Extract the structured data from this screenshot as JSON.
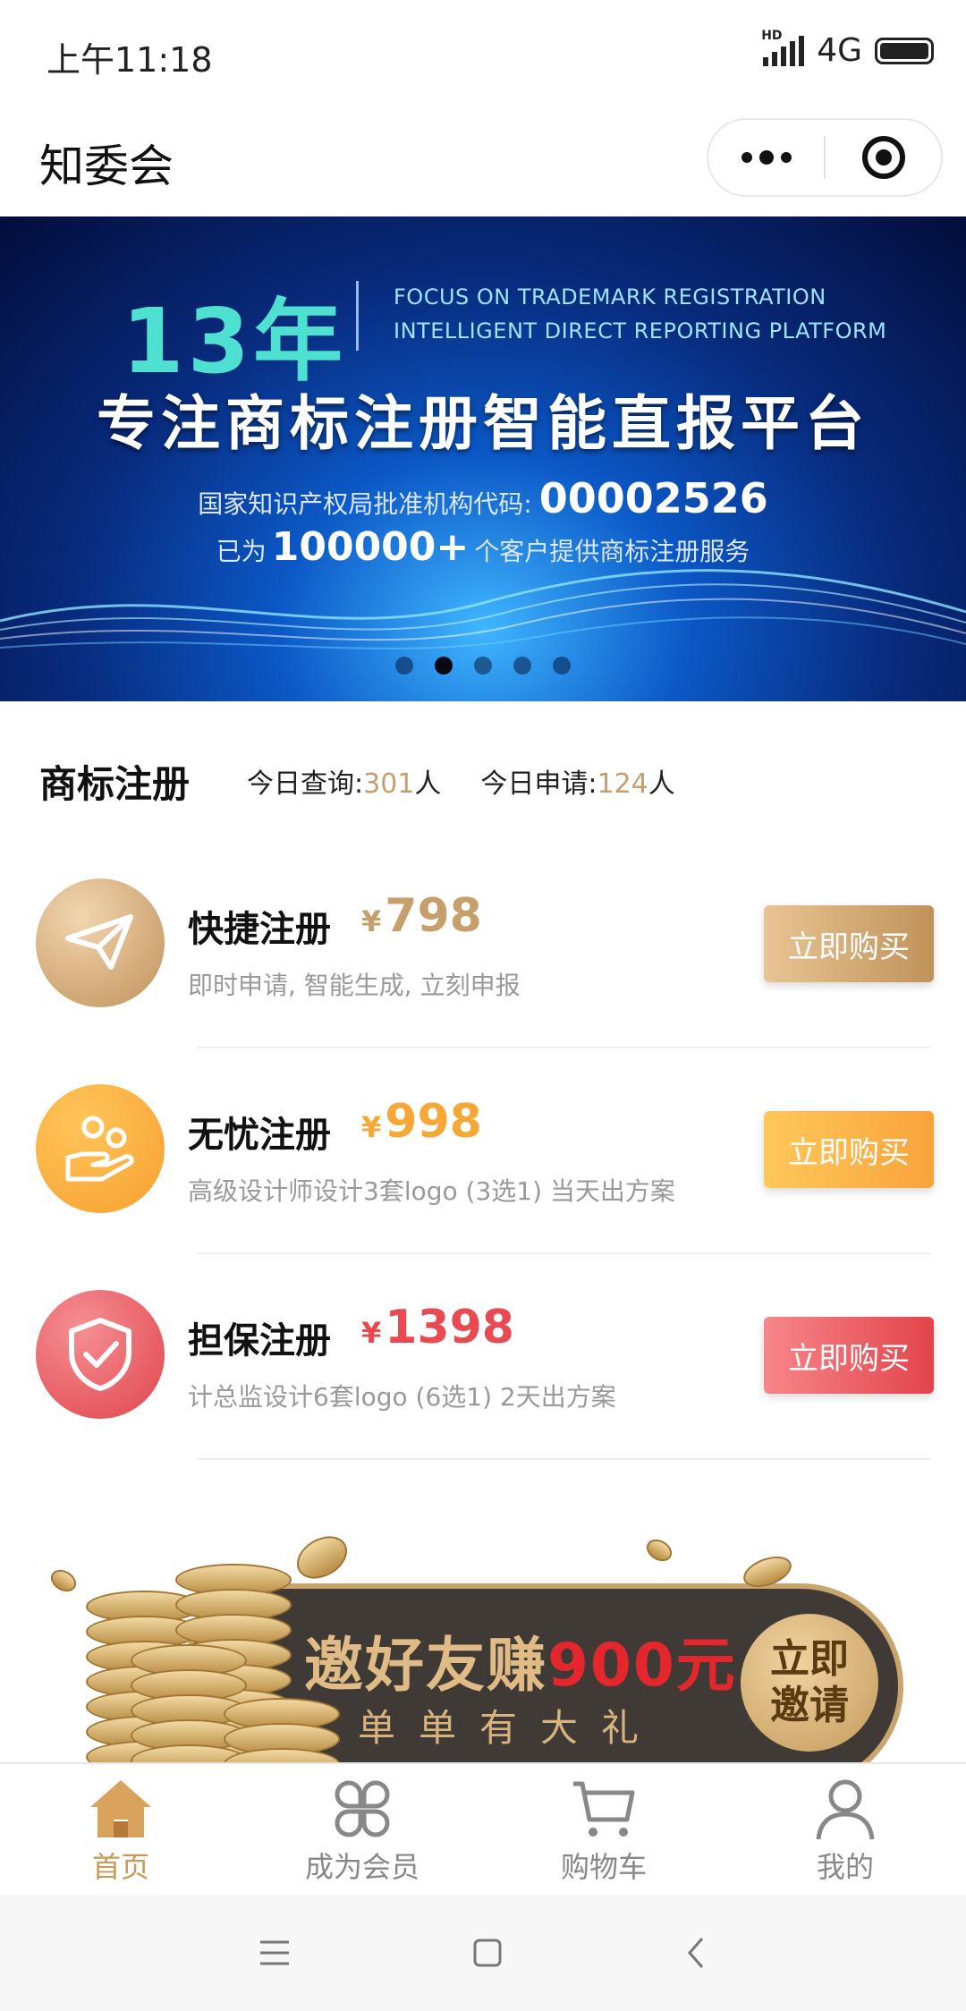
{
  "status_bar": {
    "time": "上午11:18",
    "hd": "HD",
    "network": "4G"
  },
  "title_bar": {
    "title": "知委会"
  },
  "banner": {
    "years": "13年",
    "en_line1": "FOCUS ON TRADEMARK REGISTRATION",
    "en_line2": "INTELLIGENT DIRECT REPORTING PLATFORM",
    "main": "专注商标注册智能直报平台",
    "code_label": "国家知识产权局批准机构代码:",
    "code": "00002526",
    "serve_pre": "已为",
    "serve_num": "100000+",
    "serve_post": "个客户提供商标注册服务",
    "slide_count": 5,
    "active_slide": 2
  },
  "section": {
    "title": "商标注册",
    "query_label": "今日查询:",
    "query_value": "301",
    "query_unit": "人",
    "apply_label": "今日申请:",
    "apply_value": "124",
    "apply_unit": "人"
  },
  "products": [
    {
      "name": "快捷注册",
      "currency": "¥",
      "price": "798",
      "desc": "即时申请, 智能生成, 立刻申报",
      "button": "立即购买",
      "icon": "paper-plane-icon",
      "color": "#c79f6b"
    },
    {
      "name": "无忧注册",
      "currency": "¥",
      "price": "998",
      "desc": "高级设计师设计3套logo (3选1) 当天出方案",
      "button": "立即购买",
      "icon": "hand-person-icon",
      "color": "#f7a735"
    },
    {
      "name": "担保注册",
      "currency": "¥",
      "price": "1398",
      "desc": "计总监设计6套logo (6选1) 2天出方案",
      "button": "立即购买",
      "icon": "shield-check-icon",
      "color": "#e84a52"
    }
  ],
  "invite": {
    "title_pre": "邀好友赚",
    "title_amount": "900元",
    "subtitle": "单单有大礼",
    "button_line1": "立即",
    "button_line2": "邀请"
  },
  "tabs": [
    {
      "label": "首页",
      "icon": "home-icon",
      "active": true
    },
    {
      "label": "成为会员",
      "icon": "clover-icon",
      "active": false
    },
    {
      "label": "购物车",
      "icon": "cart-icon",
      "active": false
    },
    {
      "label": "我的",
      "icon": "user-icon",
      "active": false
    }
  ],
  "colors": {
    "gold": "#c79f6b",
    "orange": "#f7a735",
    "red": "#e84a52",
    "tab_active": "#c99a5a"
  }
}
